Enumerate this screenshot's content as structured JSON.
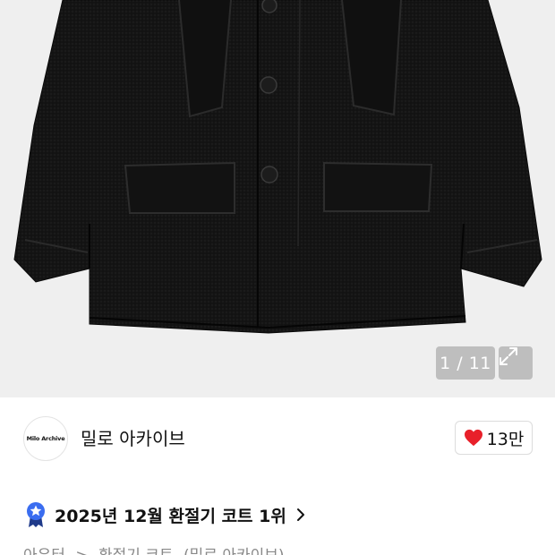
{
  "gallery": {
    "counter": "1 / 11",
    "background": "#efefef",
    "expand_icon": "expand-arrows-icon"
  },
  "brand": {
    "logo_text": "Milo Archive",
    "name": "밀로 아카이브"
  },
  "like": {
    "icon": "heart-icon",
    "color": "#e8202a",
    "count": "13만"
  },
  "ranking": {
    "badge_icon": "award-badge-icon",
    "badge_color": "#3a6df0",
    "text": "2025년 12월 환절기 코트 1위"
  },
  "breadcrumb": {
    "items": [
      "아우터",
      ">",
      "환절기 코트",
      "(밀로 아카이브)"
    ]
  }
}
